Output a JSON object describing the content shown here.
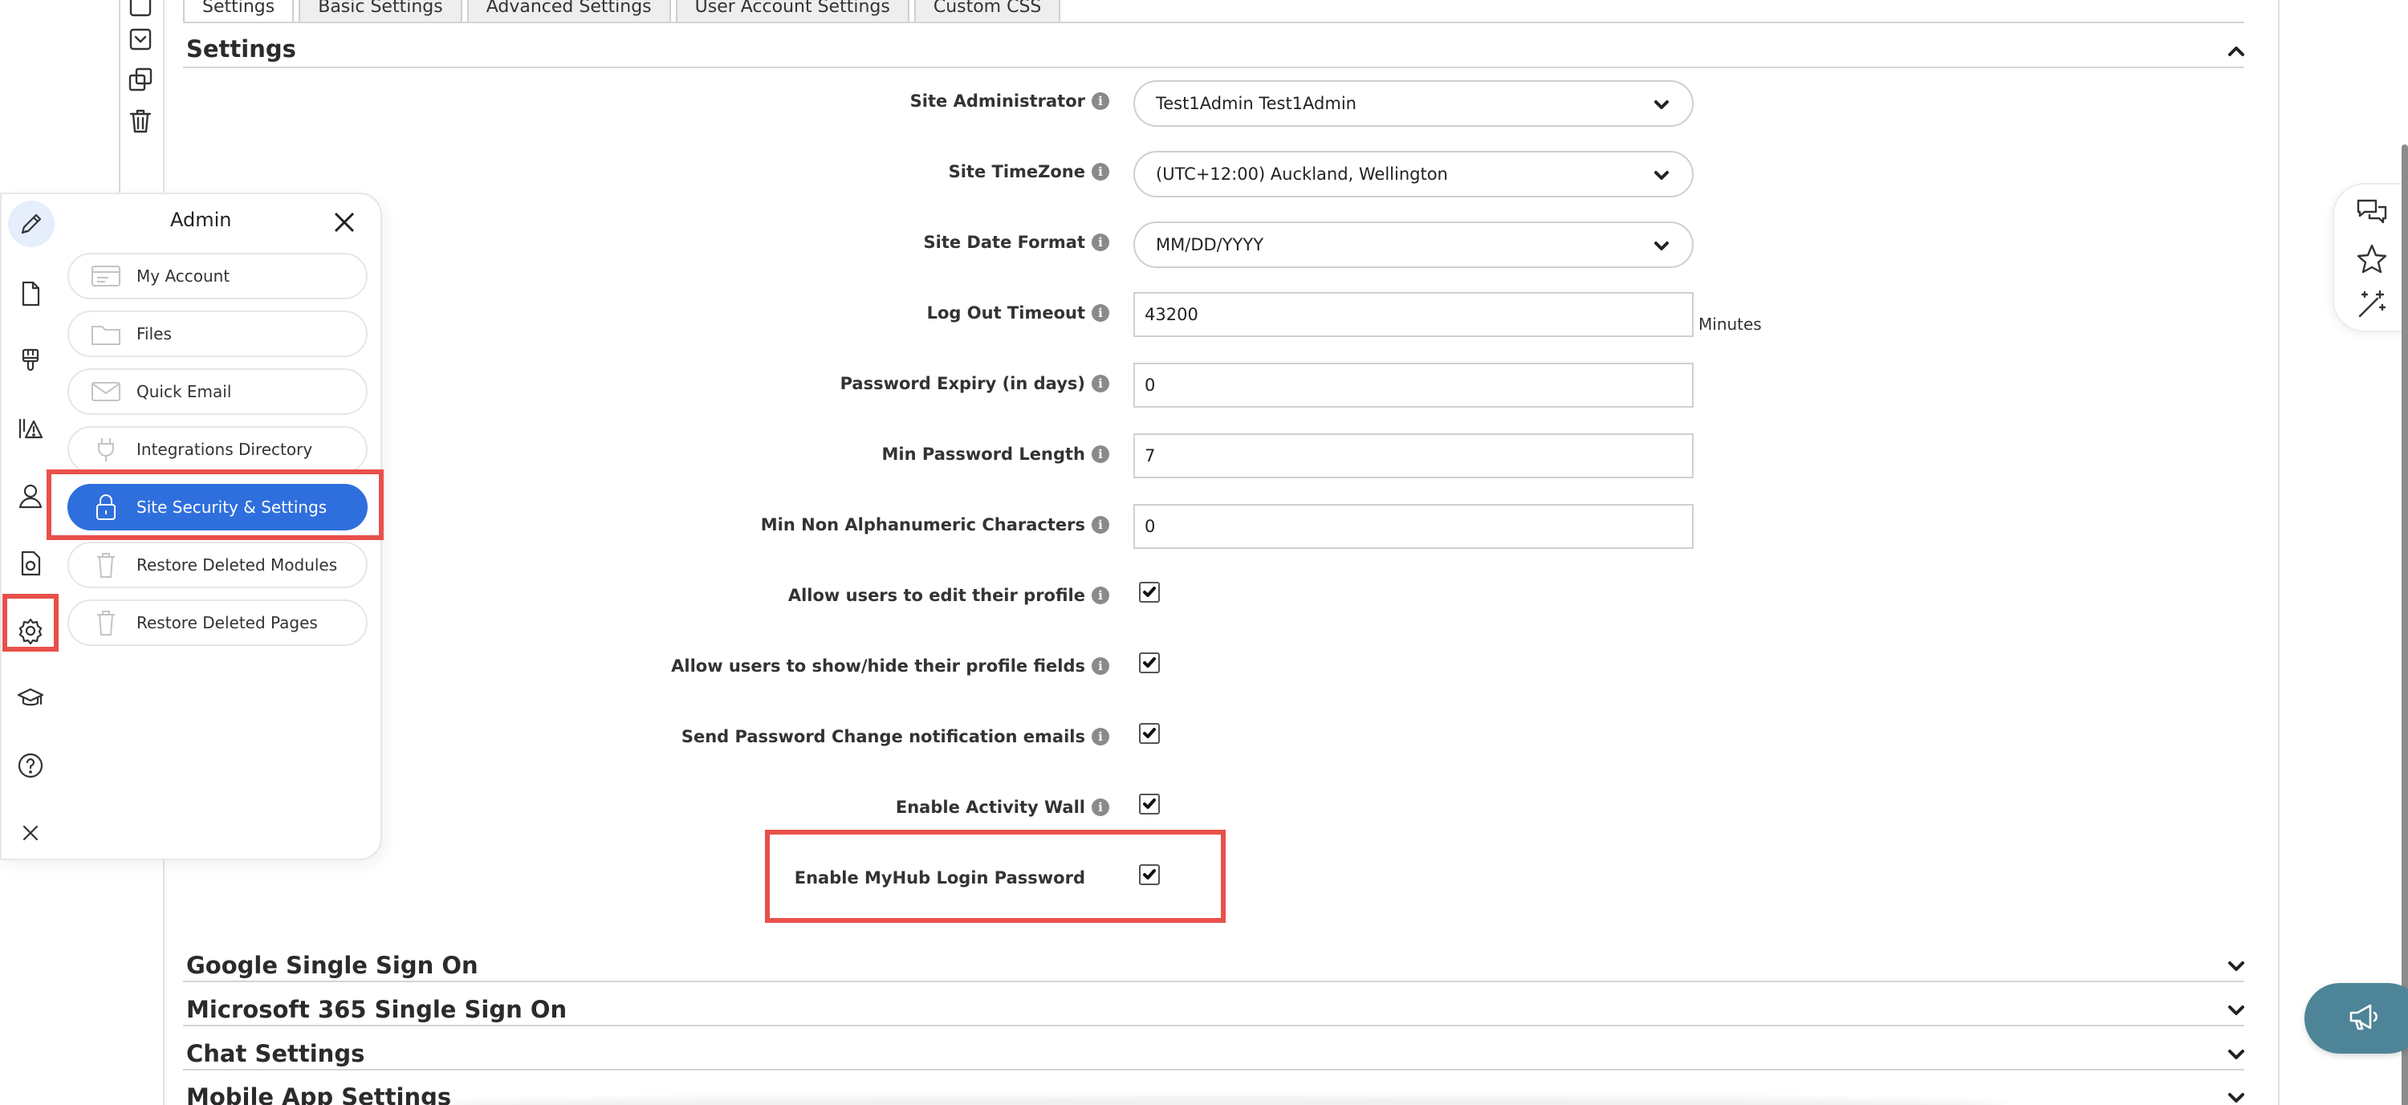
{
  "tabs": [
    "Settings",
    "Basic Settings",
    "Advanced Settings",
    "User Account Settings",
    "Custom CSS"
  ],
  "settings_section": {
    "title": "Settings"
  },
  "form": {
    "site_admin": {
      "label": "Site Administrator",
      "value": "Test1Admin Test1Admin"
    },
    "timezone": {
      "label": "Site TimeZone",
      "value": "(UTC+12:00) Auckland, Wellington"
    },
    "date_format": {
      "label": "Site Date Format",
      "value": "MM/DD/YYYY"
    },
    "logout_timeout": {
      "label": "Log Out Timeout",
      "value": "43200",
      "unit": "Minutes"
    },
    "password_expiry": {
      "label": "Password Expiry (in days)",
      "value": "0"
    },
    "min_password_length": {
      "label": "Min Password Length",
      "value": "7"
    },
    "min_non_alphanumeric": {
      "label": "Min Non Alphanumeric Characters",
      "value": "0"
    },
    "allow_edit_profile": {
      "label": "Allow users to edit their profile",
      "checked": true
    },
    "allow_show_hide_fields": {
      "label": "Allow users to show/hide their profile fields",
      "checked": true
    },
    "send_password_change": {
      "label": "Send Password Change notification emails",
      "checked": true
    },
    "enable_activity_wall": {
      "label": "Enable Activity Wall",
      "checked": true
    },
    "enable_myhub_login": {
      "label": "Enable MyHub Login Password",
      "checked": true
    },
    "info_glyph": "i"
  },
  "collapsed_sections": [
    "Google Single Sign On",
    "Microsoft 365 Single Sign On",
    "Chat Settings",
    "Mobile App Settings"
  ],
  "admin_panel": {
    "title": "Admin",
    "items": [
      {
        "label": "My Account",
        "icon": "id-card-icon"
      },
      {
        "label": "Files",
        "icon": "folder-icon"
      },
      {
        "label": "Quick Email",
        "icon": "envelope-icon"
      },
      {
        "label": "Integrations Directory",
        "icon": "plug-icon"
      },
      {
        "label": "Site Security & Settings",
        "icon": "lock-icon",
        "active": true
      },
      {
        "label": "Restore Deleted Modules",
        "icon": "trash-icon"
      },
      {
        "label": "Restore Deleted Pages",
        "icon": "trash-icon"
      }
    ]
  },
  "left_rail_icons": [
    "pencil-icon",
    "page-icon",
    "brush-icon",
    "alert-icon",
    "user-icon",
    "document-icon",
    "gear-icon",
    "graduation-cap-icon",
    "help-icon",
    "close-icon"
  ],
  "right_rail_icons": [
    "chat-icon",
    "star-icon",
    "magic-wand-icon"
  ],
  "fab_icon": "megaphone-icon",
  "colors": {
    "accent": "#2f6fdd",
    "highlight": "#e8504a",
    "fab": "#4e8497"
  }
}
